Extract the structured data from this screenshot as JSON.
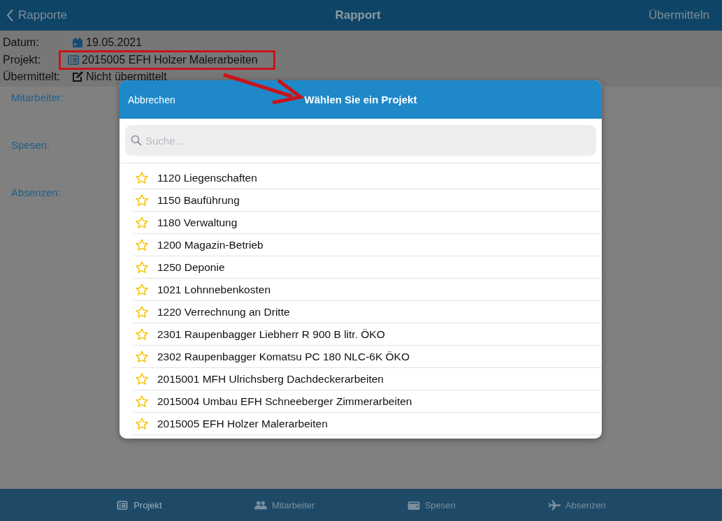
{
  "nav_bar": {
    "back_label": "Rapporte",
    "title": "Rapport",
    "action": "Übermitteln"
  },
  "details": [
    {
      "label": "Datum:",
      "value": "19.05.2021",
      "highlighted": false
    },
    {
      "label": "Projekt:",
      "value": "2015005 EFH Holzer Malerarbeiten",
      "highlighted": true
    },
    {
      "label": "Übermittelt:",
      "value": "Nicht übermittelt",
      "highlighted": false
    }
  ],
  "sections": [
    "Mitarbeiter:",
    "Spesen:",
    "Absenzen:"
  ],
  "dialog": {
    "cancel": "Abbrechen",
    "title": "Wählen Sie ein Projekt",
    "search": {
      "placeholder": "Suche..."
    },
    "items": [
      {
        "label": "1120 Liegenschaften",
        "favorite": false
      },
      {
        "label": "1150 Bauführung",
        "favorite": false
      },
      {
        "label": "1180 Verwaltung",
        "favorite": false
      },
      {
        "label": "1200 Magazin-Betrieb",
        "favorite": false
      },
      {
        "label": "1250 Deponie",
        "favorite": false
      },
      {
        "label": "1021 Lohnnebenkosten",
        "favorite": false
      },
      {
        "label": "1220 Verrechnung an Dritte",
        "favorite": false
      },
      {
        "label": "2301 Raupenbagger Liebherr R 900 B litr. ÖKO",
        "favorite": false
      },
      {
        "label": "2302 Raupenbagger Komatsu PC 180 NLC-6K ÖKO",
        "favorite": false
      },
      {
        "label": "2015001 MFH Ulrichsberg Dachdeckerarbeiten",
        "favorite": false
      },
      {
        "label": "2015004 Umbau EFH Schneeberger Zimmerarbeiten",
        "favorite": false
      },
      {
        "label": "2015005 EFH Holzer Malerarbeiten",
        "favorite": false
      }
    ]
  },
  "tab_bar": [
    {
      "label": "Projekt",
      "selected": true
    },
    {
      "label": "Mitarbeiter",
      "selected": false
    },
    {
      "label": "Spesen",
      "selected": false
    },
    {
      "label": "Absenzen",
      "selected": false
    }
  ]
}
